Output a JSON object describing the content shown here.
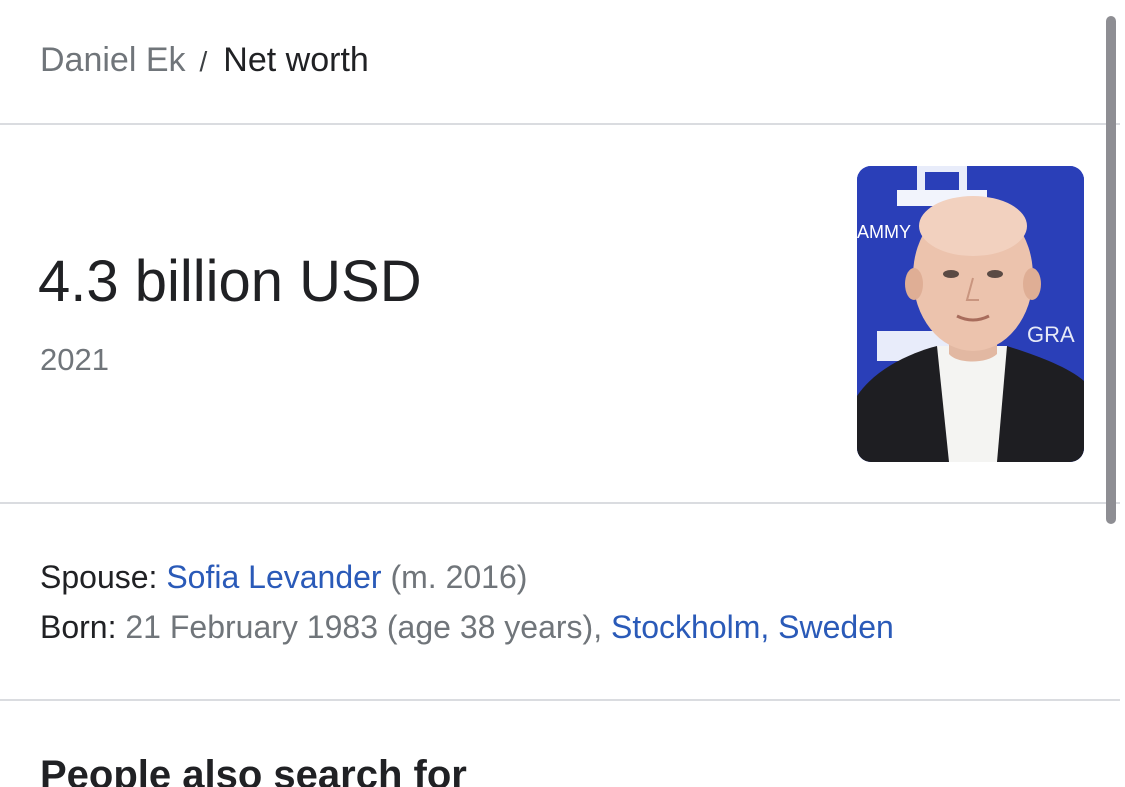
{
  "breadcrumb": {
    "parent": "Daniel Ek",
    "separator": "/",
    "current": "Net worth"
  },
  "answer": {
    "value": "4.3 billion USD",
    "year": "2021"
  },
  "photo": {
    "backdrop_text_left": "AMMY",
    "backdrop_text_right": "GRA"
  },
  "facts": {
    "spouse": {
      "label": "Spouse:",
      "name": "Sofia Levander",
      "detail": "(m. 2016)"
    },
    "born": {
      "label": "Born:",
      "detail": "21 February 1983 (age 38 years),",
      "place_city": "Stockholm,",
      "place_country": "Sweden"
    }
  },
  "section": {
    "title": "People also search for"
  },
  "colors": {
    "link": "#2a5ab8",
    "muted": "#70757a",
    "text": "#202124",
    "divider": "#dadce0",
    "photo_backdrop": "#2a3fb8"
  }
}
